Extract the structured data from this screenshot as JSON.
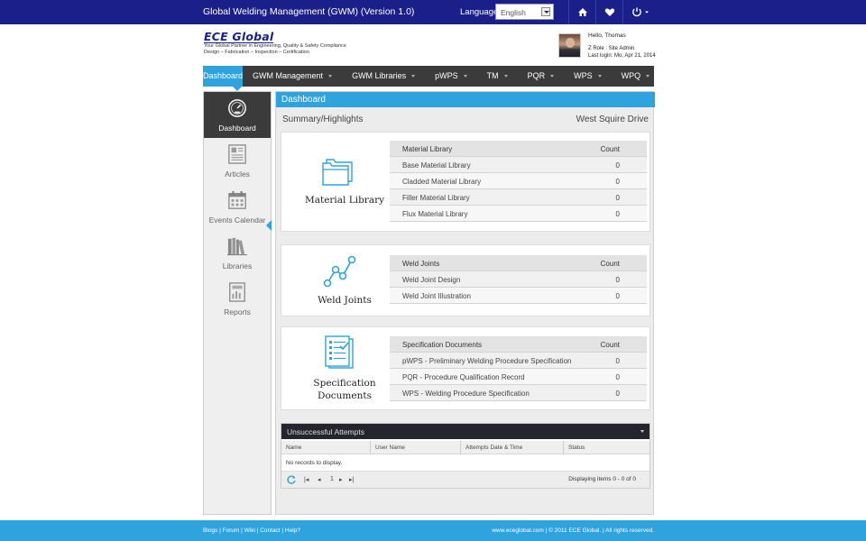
{
  "topbar": {
    "title": "Global Welding Management (GWM) (Version 1.0)",
    "language_label": "Language:",
    "language_value": "English"
  },
  "brand": {
    "logo": "ECE Global",
    "tagline1": "Your Global Partner in Engineering, Quality & Safety Compliance",
    "tagline2": "Design – Fabrication – Inspection – Certification"
  },
  "user": {
    "hello": "Hello, Thomas",
    "role": "Z  Role : Site Admin",
    "last_login": "Last login: Mo, Apr 21, 2014"
  },
  "nav": {
    "items": [
      {
        "label": "Dashboard"
      },
      {
        "label": "GWM Management"
      },
      {
        "label": "GWM Libraries"
      },
      {
        "label": "pWPS"
      },
      {
        "label": "TM"
      },
      {
        "label": "PQR"
      },
      {
        "label": "WPS"
      },
      {
        "label": "WPQ"
      }
    ]
  },
  "sidebar": {
    "items": [
      {
        "label": "Dashboard",
        "icon": "gauge-icon"
      },
      {
        "label": "Articles",
        "icon": "articles-icon"
      },
      {
        "label": "Events Calendar",
        "icon": "calendar-icon"
      },
      {
        "label": "Libraries",
        "icon": "books-icon"
      },
      {
        "label": "Reports",
        "icon": "reports-icon"
      }
    ]
  },
  "content": {
    "header": "Dashboard",
    "summary_title": "Summary/Highlights",
    "site_name": "West Squire Drive"
  },
  "panels": [
    {
      "title": "Material Library",
      "icon": "folders-icon",
      "table_header": {
        "name": "Material Library",
        "count": "Count"
      },
      "rows": [
        {
          "name": "Base Material Library",
          "count": "0"
        },
        {
          "name": "Cladded Material Library",
          "count": "0"
        },
        {
          "name": "Filler Material Library",
          "count": "0"
        },
        {
          "name": "Flux Material Library",
          "count": "0"
        }
      ]
    },
    {
      "title": "Weld Joints",
      "icon": "joints-icon",
      "table_header": {
        "name": "Weld Joints",
        "count": "Count"
      },
      "rows": [
        {
          "name": "Weld Joint Design",
          "count": "0"
        },
        {
          "name": "Weld Joint Illustration",
          "count": "0"
        }
      ]
    },
    {
      "title1": "Specification",
      "title2": "Documents",
      "icon": "spec-docs-icon",
      "table_header": {
        "name": "Specification Documents",
        "count": "Count"
      },
      "rows": [
        {
          "name": "pWPS - Preliminary Welding Procedure Specification",
          "count": "0"
        },
        {
          "name": "PQR - Procedure Qualification Record",
          "count": "0"
        },
        {
          "name": "WPS - Welding Procedure Specification",
          "count": "0"
        }
      ]
    }
  ],
  "grid": {
    "title": "Unsuccessful Attempts",
    "columns": [
      "Name",
      "User Name",
      "Attempts Date & Time",
      "Status"
    ],
    "empty_text": "No records to display.",
    "page": "1",
    "summary": "Displaying items 0 - 0 of 0"
  },
  "footer": {
    "links": "Blogs | Forum | Wiki | Contact | Help?",
    "copyright": "www.eceglobal.com | © 2011 ECE Global. | All rights reserved."
  },
  "colors": {
    "topbar": "#1a1f8a",
    "accent": "#2ea3dd",
    "nav": "#3b3b3b"
  }
}
